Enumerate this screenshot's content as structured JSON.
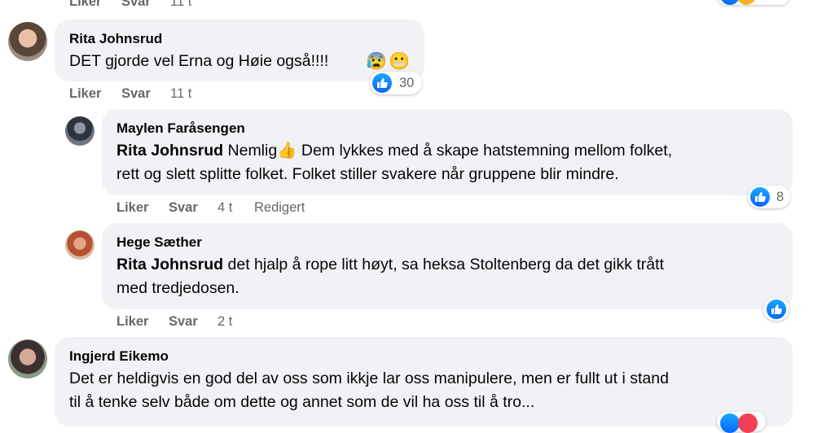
{
  "top": {
    "like": "Liker",
    "reply": "Svar",
    "time": "11 t"
  },
  "comments": [
    {
      "author": "Rita Johnsrud",
      "text": "DET gjorde vel Erna og Høie også!!!!",
      "emojis": [
        "😰",
        "😬"
      ],
      "like": "Liker",
      "reply": "Svar",
      "time": "11 t",
      "reactions": "30"
    },
    {
      "author": "Maylen Faråsengen",
      "mention": "Rita Johnsrud",
      "line1": "Nemlig👍 Dem lykkes med å skape hatstemning mellom folket,",
      "line2": "rett og slett splitte folket. Folket stiller svakere når gruppene blir mindre.",
      "like": "Liker",
      "reply": "Svar",
      "time": "4 t",
      "edited": "Redigert",
      "reactions": "8"
    },
    {
      "author": "Hege Sæther",
      "mention": "Rita Johnsrud",
      "line1": "det hjalp å rope litt høyt, sa heksa Stoltenberg da det gikk trått",
      "line2": "med tredjedosen.",
      "like": "Liker",
      "reply": "Svar",
      "time": "2 t"
    },
    {
      "author": "Ingjerd Eikemo",
      "line1": "Det er heldigvis en god del av oss som ikkje lar oss manipulere, men er fullt ut i stand",
      "line2": "til å tenke selv både om dette og annet som de vil ha oss til å tro..."
    }
  ],
  "colors": {
    "bubble": "#f0f2f5",
    "like_blue": "#0866ff",
    "meta": "#65676b"
  }
}
